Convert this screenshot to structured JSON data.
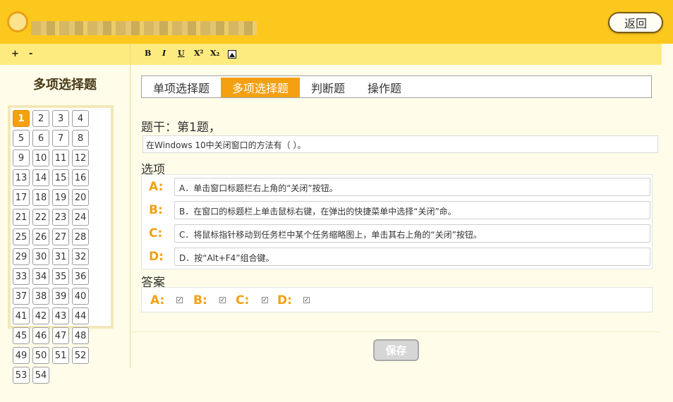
{
  "header": {
    "back_label": "返回"
  },
  "toolbar": {
    "zoom_in": "+",
    "zoom_out": "-",
    "bold": "B",
    "italic": "I",
    "underline": "U",
    "superscript": "X²",
    "subscript": "X₂"
  },
  "sidebar": {
    "title": "多项选择题",
    "numbers": [
      "1",
      "2",
      "3",
      "4",
      "5",
      "6",
      "7",
      "8",
      "9",
      "10",
      "11",
      "12",
      "13",
      "14",
      "15",
      "16",
      "17",
      "18",
      "19",
      "20",
      "21",
      "22",
      "23",
      "24",
      "25",
      "26",
      "27",
      "28",
      "29",
      "30",
      "31",
      "32",
      "33",
      "34",
      "35",
      "36",
      "37",
      "38",
      "39",
      "40",
      "41",
      "42",
      "43",
      "44",
      "45",
      "46",
      "47",
      "48",
      "49",
      "50",
      "51",
      "52",
      "53",
      "54"
    ],
    "active_number": "1"
  },
  "tabs": [
    {
      "label": "单项选择题"
    },
    {
      "label": "多项选择题",
      "active": true
    },
    {
      "label": "判断题"
    },
    {
      "label": "操作题"
    }
  ],
  "question": {
    "stem_label": "题干：第1题，",
    "stem_text": "在Windows 10中关闭窗口的方法有（ ）。",
    "options_label": "选项",
    "options": [
      {
        "letter": "A:",
        "text": "A．单击窗口标题栏右上角的“关闭”按钮。"
      },
      {
        "letter": "B:",
        "text": "B．在窗口的标题栏上单击鼠标右键，在弹出的快捷菜单中选择“关闭”命。"
      },
      {
        "letter": "C:",
        "text": "C．将鼠标指针移动到任务栏中某个任务缩略图上，单击其右上角的“关闭”按钮。"
      },
      {
        "letter": "D:",
        "text": "D．按“Alt+F4”组合键。"
      }
    ],
    "answer_label": "答案",
    "answers": [
      {
        "letter": "A:",
        "checked": true
      },
      {
        "letter": "B:",
        "checked": true
      },
      {
        "letter": "C:",
        "checked": true
      },
      {
        "letter": "D:",
        "checked": true
      }
    ]
  },
  "footer": {
    "save_label": "保存"
  },
  "colors": {
    "header": "#fdc81d",
    "toolbar": "#feeb7f",
    "accent": "#f4a011",
    "background": "#fffde9"
  }
}
